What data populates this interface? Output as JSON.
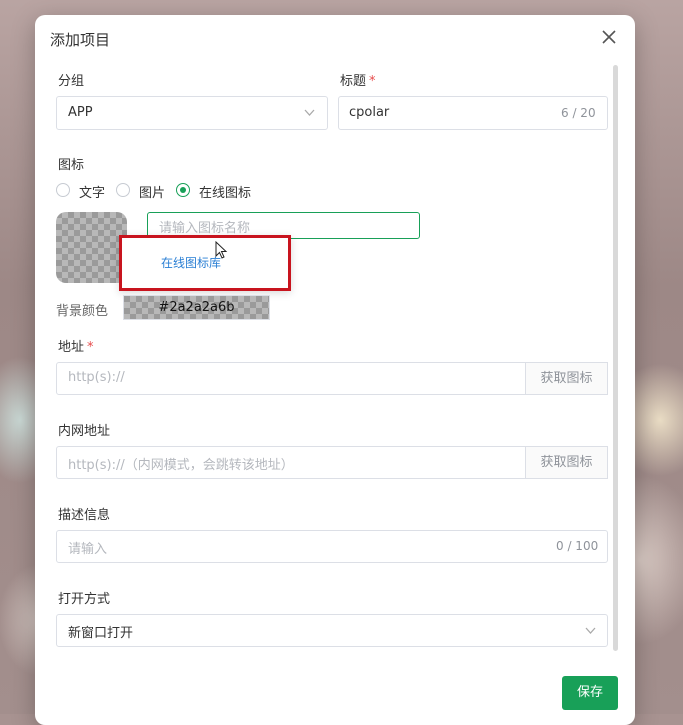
{
  "dialog": {
    "title": "添加项目"
  },
  "form": {
    "group": {
      "label": "分组",
      "value": "APP"
    },
    "title": {
      "label": "标题",
      "required_mark": "*",
      "value": "cpolar",
      "counter": "6 / 20"
    },
    "icon": {
      "label": "图标",
      "options": [
        "文字",
        "图片",
        "在线图标"
      ],
      "selected": "在线图标",
      "search_placeholder": "请输入图标名称",
      "dropdown_link": "在线图标库"
    },
    "bg_color": {
      "label": "背景颜色",
      "value": "#2a2a2a6b"
    },
    "address": {
      "label": "地址",
      "required_mark": "*",
      "placeholder": "http(s)://",
      "button": "获取图标"
    },
    "intranet": {
      "label": "内网地址",
      "placeholder": "http(s)://（内网模式，会跳转该地址）",
      "button": "获取图标"
    },
    "description": {
      "label": "描述信息",
      "placeholder": "请输入",
      "counter": "0 / 100"
    },
    "open_mode": {
      "label": "打开方式",
      "value": "新窗口打开"
    }
  },
  "footer": {
    "save_label": "保存"
  },
  "colors": {
    "accent": "#18a058",
    "required": "#e64a4a",
    "highlight_box": "#c8141e"
  }
}
